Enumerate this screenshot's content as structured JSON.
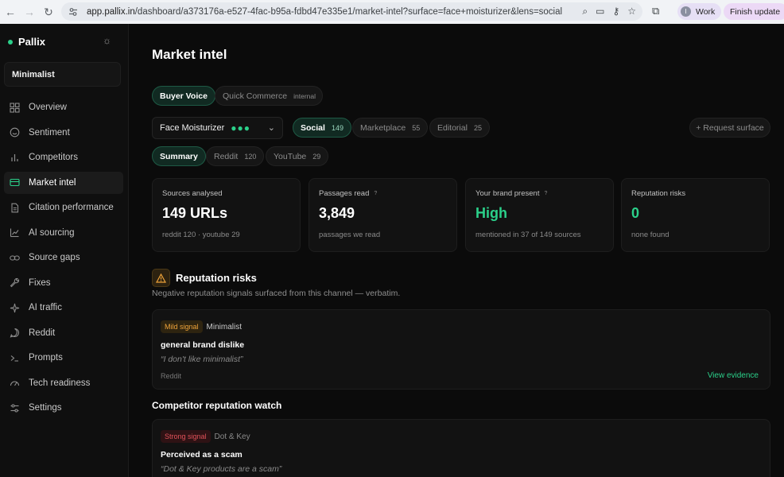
{
  "browser": {
    "url_host": "app.pallix.in",
    "url_path": "/dashboard/a373176a-e527-4fac-b95a-fdbd47e335e1/market-intel?surface=face+moisturizer&lens=social",
    "profile_initial": "I",
    "profile_label": "Work",
    "update_label": "Finish update"
  },
  "sidebar": {
    "brand": "Pallix",
    "workspace": "Minimalist",
    "items": [
      {
        "label": "Overview",
        "icon": "grid-icon"
      },
      {
        "label": "Sentiment",
        "icon": "smile-icon"
      },
      {
        "label": "Competitors",
        "icon": "bar-chart-icon"
      },
      {
        "label": "Market intel",
        "icon": "card-icon",
        "active": true
      },
      {
        "label": "Citation performance",
        "icon": "document-icon"
      },
      {
        "label": "AI sourcing",
        "icon": "chart-up-icon"
      },
      {
        "label": "Source gaps",
        "icon": "link-icon"
      },
      {
        "label": "Fixes",
        "icon": "wrench-icon"
      },
      {
        "label": "AI traffic",
        "icon": "sparkle-icon"
      },
      {
        "label": "Reddit",
        "icon": "chat-bubble-icon"
      },
      {
        "label": "Prompts",
        "icon": "terminal-icon"
      },
      {
        "label": "Tech readiness",
        "icon": "gauge-icon"
      },
      {
        "label": "Settings",
        "icon": "sliders-icon"
      }
    ]
  },
  "main": {
    "title": "Market intel",
    "tabs": [
      {
        "label": "Buyer Voice",
        "active": true
      },
      {
        "label": "Quick Commerce",
        "tag": "internal"
      }
    ],
    "surface_select": {
      "value": "Face Moisturizer",
      "dots": "●●●"
    },
    "lenses": [
      {
        "label": "Social",
        "count": "149",
        "active": true
      },
      {
        "label": "Marketplace",
        "count": "55"
      },
      {
        "label": "Editorial",
        "count": "25"
      }
    ],
    "request_label": "+ Request surface",
    "subtabs": [
      {
        "label": "Summary",
        "active": true
      },
      {
        "label": "Reddit",
        "count": "120"
      },
      {
        "label": "YouTube",
        "count": "29"
      }
    ],
    "stats": [
      {
        "label": "Sources analysed",
        "help": "",
        "value": "149 URLs",
        "sub": "reddit 120 · youtube 29"
      },
      {
        "label": "Passages read",
        "help": "?",
        "value": "3,849",
        "sub": "passages we read"
      },
      {
        "label": "Your brand present",
        "help": "?",
        "value": "High",
        "sub": "mentioned in 37 of 149 sources"
      },
      {
        "label": "Reputation risks",
        "help": "",
        "value": "0",
        "sub": "none found"
      }
    ],
    "reputation": {
      "title": "Reputation risks",
      "desc": "Negative reputation signals surfaced from this channel — verbatim.",
      "card": {
        "badge": "Mild signal",
        "brand": "Minimalist",
        "title": "general brand dislike",
        "quote": "“I don't like minimalist”",
        "source": "Reddit",
        "link": "View evidence"
      }
    },
    "competitor": {
      "title": "Competitor reputation watch",
      "card": {
        "badge": "Strong signal",
        "brand": "Dot & Key",
        "title": "Perceived as a scam",
        "quote": "“Dot & Key products are a scam”"
      }
    }
  },
  "colors": {
    "accent": "#2bd08a",
    "mild": "#f0a43a",
    "strong": "#e2525a",
    "background": "#0b0b0b"
  }
}
